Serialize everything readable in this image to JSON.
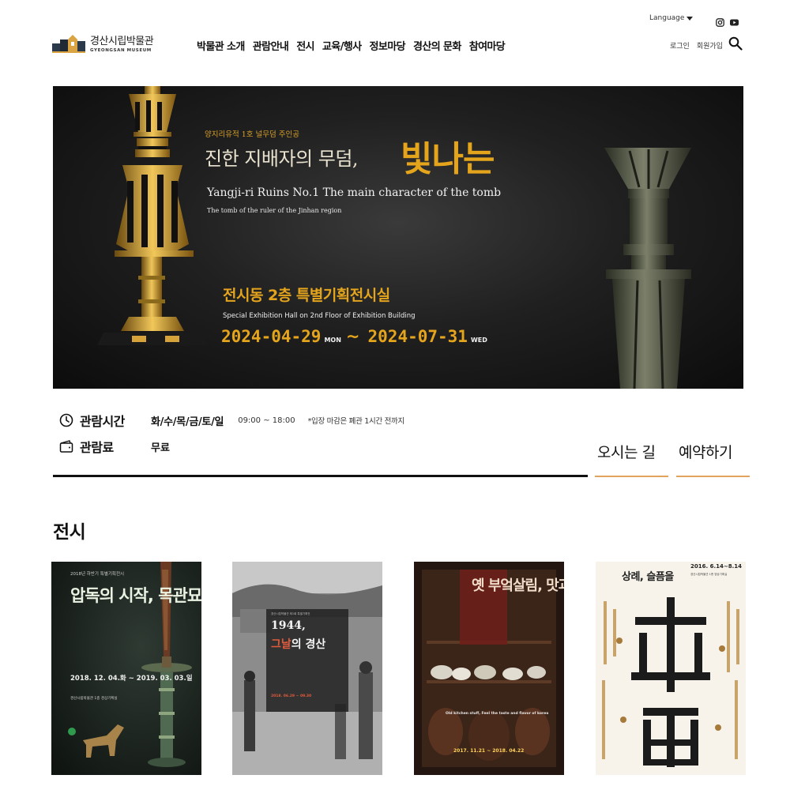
{
  "header": {
    "language_label": "Language",
    "logo": {
      "name_ko": "경산시립박물관",
      "name_en": "GYEONGSAN MUSEUM"
    },
    "nav": [
      "박물관 소개",
      "관람안내",
      "전시",
      "교육/행사",
      "정보마당",
      "경산의 문화",
      "참여마당"
    ],
    "member": {
      "login": "로그인",
      "signup": "회원가입"
    },
    "sns": [
      "instagram-icon",
      "youtube-icon"
    ]
  },
  "hero": {
    "subtitle": "양지리유적 1호 널무덤 주인공",
    "title": "진한 지배자의 무덤,",
    "title_highlight": "빛나는",
    "title_en": "Yangji-ri Ruins No.1 The main character of the tomb",
    "subtitle_en": "The tomb of the ruler of the Jinhan region",
    "hall": "전시동 2층 특별기획전시실",
    "hall_en": "Special Exhibition Hall on 2nd Floor of Exhibition Building",
    "start_date": "2024-04-29",
    "start_day": "MON",
    "tilde": "~",
    "end_date": "2024-07-31",
    "end_day": "WED"
  },
  "visit_info": {
    "hours_label": "관람시간",
    "days": "화/수/목/금/토/일",
    "hours": "09:00 ~ 18:00",
    "note": "*입장 마감은 폐관 1시간 전까지",
    "fee_label": "관람료",
    "fee": "무료"
  },
  "quick_links": {
    "directions": "오시는 길",
    "reservation": "예약하기"
  },
  "exhibitions": {
    "section_title": "전시",
    "cards": [
      {
        "top_text": "2018년 하반기 특별기획전시",
        "title": "압독의\n시작,\n목관묘",
        "date": "2018. 12. 04.화 ~\n2019. 03. 03.일",
        "hall": "경산시립박물관 1층 경상기획실"
      },
      {
        "small": "경산시립박물관 제1회 특별기획전",
        "title_line1": "1944,",
        "title_red": "그날",
        "title_rest": "의 경산",
        "date": "2018. 06.29 ~ 09.30"
      },
      {
        "title": "옛 부엌살림,\n맛과\n멋을\n담다",
        "subtitle_en": "Old kitchen stuff, Feel the taste and flavor of korea",
        "date": "2017. 11.21 ~ 2018. 04.22"
      },
      {
        "title": "상례, 슬픔을",
        "date": "2016. 6.14~8.14",
        "sub": "경산시립박물관 1층 영상기획실"
      }
    ]
  },
  "colors": {
    "accent_gold": "#e4a51d",
    "quick_underline": "#e1a35e"
  }
}
